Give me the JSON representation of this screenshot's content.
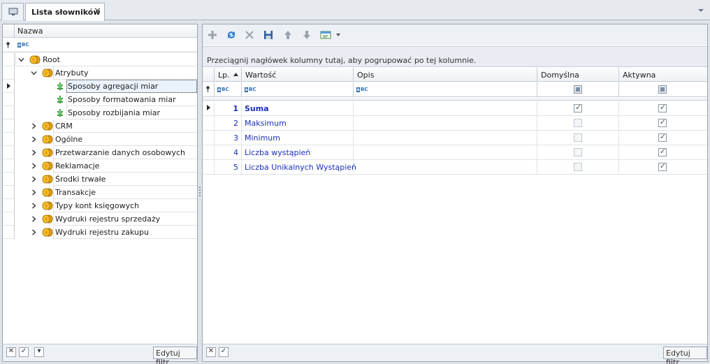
{
  "tabs": {
    "home_icon": "monitor-icon",
    "active_label": "Lista słowników",
    "close_glyph": "✕"
  },
  "left": {
    "column_header": "Nazwa",
    "filter_icon": "abc-filter-icon",
    "tree": [
      {
        "label": "Root",
        "level": 0,
        "expanded": true,
        "icon": "coins-icon"
      },
      {
        "label": "Atrybuty",
        "level": 1,
        "expanded": true,
        "icon": "coins-icon"
      },
      {
        "label": "Sposoby agregacji miar",
        "level": 2,
        "icon": "leaf-icon",
        "selected": true
      },
      {
        "label": "Sposoby formatowania miar",
        "level": 2,
        "icon": "leaf-icon"
      },
      {
        "label": "Sposoby rozbijania miar",
        "level": 2,
        "icon": "leaf-icon"
      },
      {
        "label": "CRM",
        "level": 1,
        "expanded": false,
        "icon": "coins-icon"
      },
      {
        "label": "Ogólne",
        "level": 1,
        "expanded": false,
        "icon": "coins-icon"
      },
      {
        "label": "Przetwarzanie danych osobowych",
        "level": 1,
        "expanded": false,
        "icon": "coins-icon"
      },
      {
        "label": "Reklamacje",
        "level": 1,
        "expanded": false,
        "icon": "coins-icon"
      },
      {
        "label": "Środki trwałe",
        "level": 1,
        "expanded": false,
        "icon": "coins-icon"
      },
      {
        "label": "Transakcje",
        "level": 1,
        "expanded": false,
        "icon": "coins-icon"
      },
      {
        "label": "Typy kont księgowych",
        "level": 1,
        "expanded": false,
        "icon": "coins-icon"
      },
      {
        "label": "Wydruki rejestru sprzedaży",
        "level": 1,
        "expanded": false,
        "icon": "coins-icon"
      },
      {
        "label": "Wydruki rejestru zakupu",
        "level": 1,
        "expanded": false,
        "icon": "coins-icon"
      }
    ],
    "footer": {
      "edit_filter": "Edytuj filtr"
    }
  },
  "right": {
    "toolbar": [
      "add-icon",
      "refresh-icon",
      "delete-icon",
      "save-icon",
      "move-up-icon",
      "move-down-icon",
      "export-icon"
    ],
    "group_hint": "Przeciągnij nagłówek kolumny tutaj, aby pogrupować po tej kolumnie.",
    "columns": {
      "lp": "Lp.",
      "wartosc": "Wartość",
      "opis": "Opis",
      "domyslna": "Domyślna",
      "aktywna": "Aktywna"
    },
    "rows": [
      {
        "lp": "1",
        "wartosc": "Suma",
        "opis": "",
        "domyslna": true,
        "aktywna": true,
        "bold": true,
        "current": true
      },
      {
        "lp": "2",
        "wartosc": "Maksimum",
        "opis": "",
        "domyslna": false,
        "aktywna": true
      },
      {
        "lp": "3",
        "wartosc": "Minimum",
        "opis": "",
        "domyslna": false,
        "aktywna": true
      },
      {
        "lp": "4",
        "wartosc": "Liczba wystąpień",
        "opis": "",
        "domyslna": false,
        "aktywna": true
      },
      {
        "lp": "5",
        "wartosc": "Liczba Unikalnych Wystąpień",
        "opis": "",
        "domyslna": false,
        "aktywna": true
      }
    ],
    "footer": {
      "edit_filter": "Edytuj filtr"
    }
  }
}
